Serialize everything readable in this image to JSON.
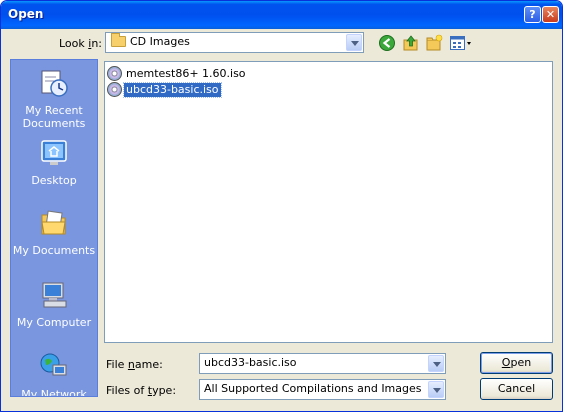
{
  "window": {
    "title": "Open"
  },
  "titlebar_buttons": {
    "help": "?",
    "close": "✕"
  },
  "look_in": {
    "label_pre": "Look ",
    "label_underline": "i",
    "label_post": "n:",
    "value": "CD Images"
  },
  "toolbar": {
    "icons": [
      "back-icon",
      "up-folder-icon",
      "new-folder-icon",
      "view-menu-icon"
    ]
  },
  "places": [
    {
      "label": "My Recent Documents",
      "icon": "recent-documents-icon"
    },
    {
      "label": "Desktop",
      "icon": "desktop-icon"
    },
    {
      "label": "My Documents",
      "icon": "my-documents-icon"
    },
    {
      "label": "My Computer",
      "icon": "my-computer-icon"
    },
    {
      "label": "My Network",
      "icon": "my-network-icon"
    }
  ],
  "files": [
    {
      "name": "memtest86+ 1.60.iso",
      "selected": false
    },
    {
      "name": "ubcd33-basic.iso",
      "selected": true
    }
  ],
  "file_name": {
    "label_pre": "File ",
    "label_underline": "n",
    "label_post": "ame:",
    "value": "ubcd33-basic.iso"
  },
  "file_type": {
    "label_pre": "Files of ",
    "label_underline": "t",
    "label_post": "ype:",
    "value": "All Supported Compilations and Images"
  },
  "buttons": {
    "open": {
      "underline": "O",
      "rest": "pen"
    },
    "cancel": "Cancel"
  },
  "colors": {
    "titlebar": "#0054e3",
    "places_bg": "#7a96df",
    "selection": "#316ac5",
    "dialog_bg": "#ece9d8"
  }
}
